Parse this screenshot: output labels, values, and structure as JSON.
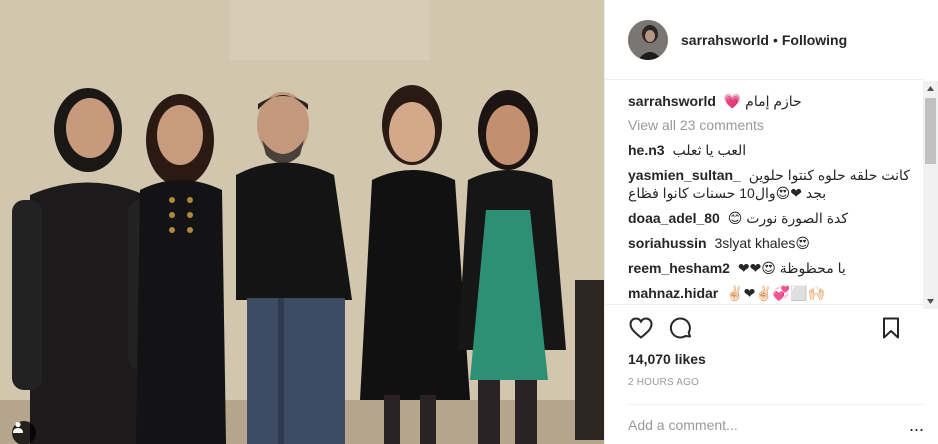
{
  "header": {
    "username": "sarrahsworld",
    "separator": "•",
    "follow_status": "Following"
  },
  "comments": {
    "caption": {
      "user": "sarrahsworld",
      "text": "حازم إمام 💗"
    },
    "view_all": "View all 23 comments",
    "items": [
      {
        "user": "he.n3",
        "text": "العب يا ثعلب"
      },
      {
        "user": "yasmien_sultan_",
        "text": "كانت حلقه حلوه كنتوا حلوين بجد ❤😍وال10 حسنات كانوا فظاع"
      },
      {
        "user": "doaa_adel_80",
        "text": "كدة الصورة نورت 😊"
      },
      {
        "user": "soriahussin",
        "text": "3slyat khales😍"
      },
      {
        "user": "reem_hesham2",
        "text": "يا محظوظة 😍❤❤"
      },
      {
        "user": "mahnaz.hidar",
        "text": "✌🏻❤✌🏻💞⬜🙌🏻"
      }
    ]
  },
  "actions": {
    "like_icon": "heart-icon",
    "comment_icon": "comment-icon",
    "save_icon": "bookmark-icon"
  },
  "likes": "14,070 likes",
  "timestamp": "2 hours ago",
  "add_comment": {
    "placeholder": "Add a comment...",
    "more": "..."
  },
  "colors": {
    "text": "#262626",
    "muted": "#999999",
    "border": "#efefef"
  }
}
